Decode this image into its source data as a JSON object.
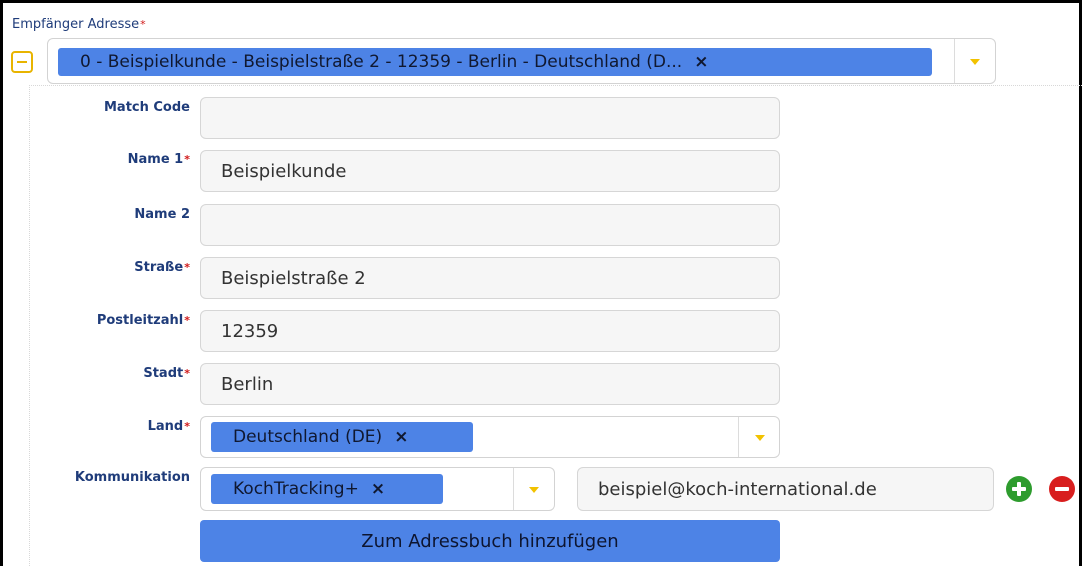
{
  "recipient": {
    "label": "Empfänger Adresse",
    "required_mark": "*",
    "selected_value": "0 - Beispielkunde - Beispielstraße 2 - 12359 - Berlin - Deutschland (D...",
    "remove_glyph": "×"
  },
  "fields": {
    "match_code": {
      "label": "Match Code",
      "value": ""
    },
    "name1": {
      "label": "Name 1",
      "required_mark": "*",
      "value": "Beispielkunde"
    },
    "name2": {
      "label": "Name 2",
      "value": ""
    },
    "street": {
      "label": "Straße",
      "required_mark": "*",
      "value": "Beispielstraße 2"
    },
    "zip": {
      "label": "Postleitzahl",
      "required_mark": "*",
      "value": "12359"
    },
    "city": {
      "label": "Stadt",
      "required_mark": "*",
      "value": "Berlin"
    },
    "country": {
      "label": "Land",
      "required_mark": "*",
      "value": "Deutschland (DE)",
      "remove_glyph": "×"
    },
    "communication": {
      "label": "Kommunikation",
      "type_value": "KochTracking+",
      "remove_glyph": "×",
      "address_value": "beispiel@koch-international.de"
    }
  },
  "actions": {
    "add_to_addressbook_label": "Zum Adressbuch hinzufügen"
  },
  "icons": {
    "collapse": "minus-square-icon",
    "caret": "chevron-down-icon",
    "add": "plus-circle-icon",
    "remove": "minus-circle-icon"
  },
  "colors": {
    "chip": "#4d83e6",
    "required": "#d11a1a",
    "label": "#1f3c7a",
    "caret": "#f2c200",
    "add": "#2e9c2e",
    "remove": "#d81e1e",
    "collapse": "#e8b400"
  }
}
